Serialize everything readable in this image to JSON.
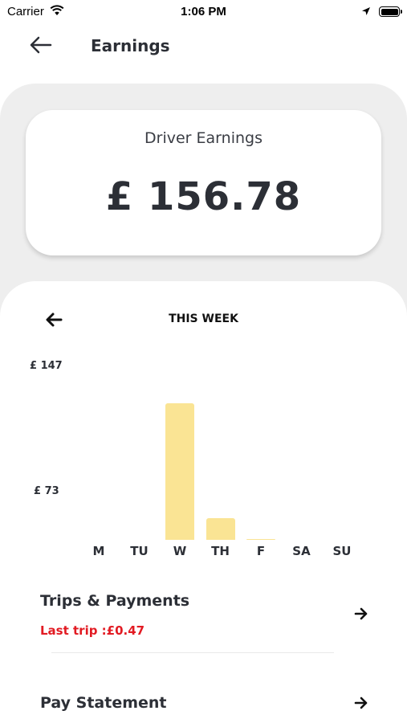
{
  "status_bar": {
    "carrier": "Carrier",
    "time": "1:06 PM"
  },
  "header": {
    "title": "Earnings"
  },
  "earnings_card": {
    "label": "Driver Earnings",
    "amount": "£ 156.78"
  },
  "weekly": {
    "title": "THIS WEEK"
  },
  "chart_data": {
    "type": "bar",
    "categories": [
      "M",
      "TU",
      "W",
      "TH",
      "F",
      "SA",
      "SU"
    ],
    "values": [
      0,
      0,
      147,
      23,
      0.47,
      0,
      0
    ],
    "ytick_labels": [
      "£ 147",
      "£ 73"
    ],
    "bar_color": "#fae494",
    "title": "",
    "xlabel": "",
    "ylabel": ""
  },
  "menu": [
    {
      "title": "Trips & Payments",
      "subtitle": "Last trip :£0.47"
    },
    {
      "title": "Pay Statement"
    }
  ],
  "colors": {
    "accent_red": "#e21b23",
    "text_dark": "#2c2f36",
    "background_gray": "#eeeeee"
  }
}
